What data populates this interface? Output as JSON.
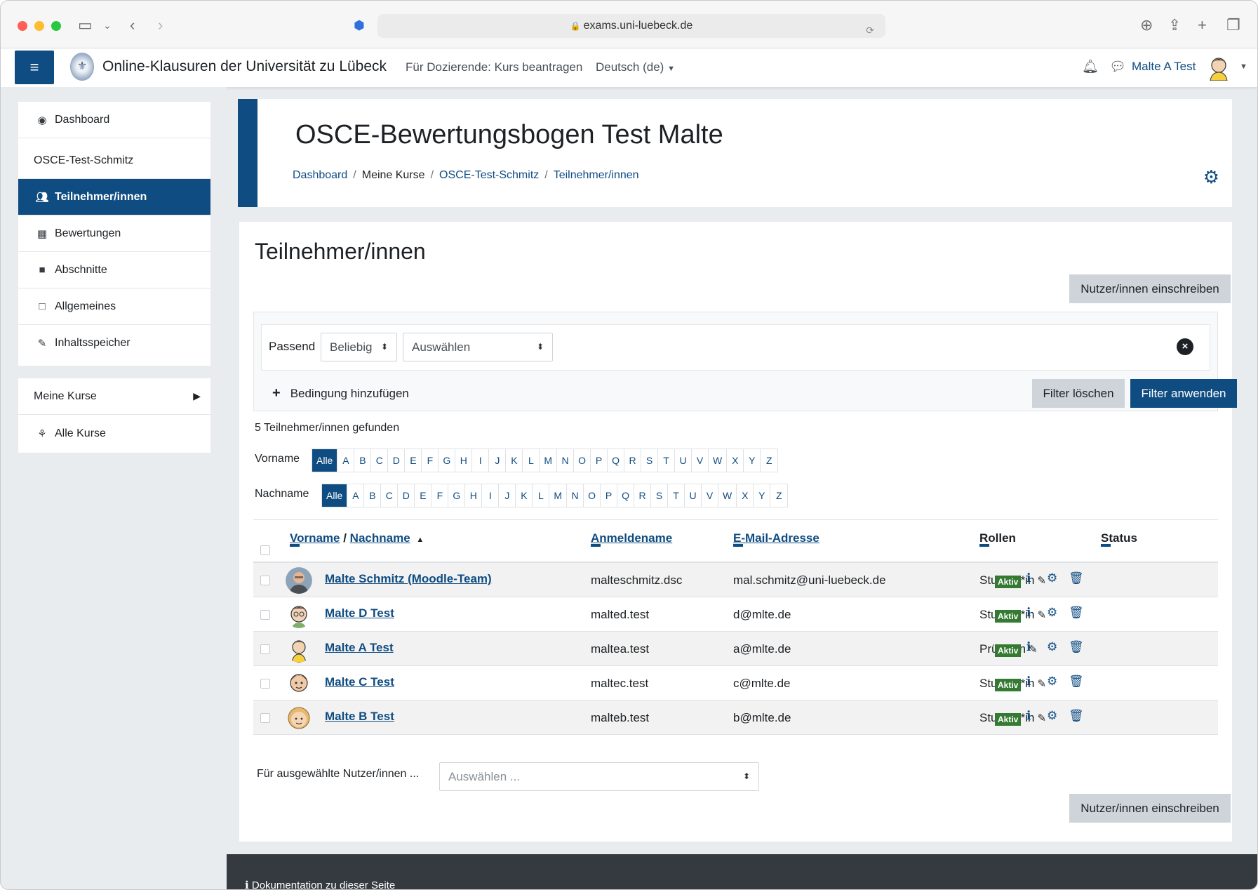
{
  "browser": {
    "url": "exams.uni-luebeck.de"
  },
  "navbar": {
    "site_name": "Online-Klausuren der Universität zu Lübeck",
    "links": [
      "Für Dozierende: Kurs beantragen",
      "Deutsch (de)"
    ],
    "user_name": "Malte A Test"
  },
  "drawer": {
    "course_items": [
      {
        "label": "Dashboard",
        "icon": "dashboard-icon"
      },
      {
        "label": "OSCE-Test-Schmitz",
        "icon": ""
      },
      {
        "label": "Teilnehmer/innen",
        "icon": "users-icon",
        "active": true
      },
      {
        "label": "Bewertungen",
        "icon": "table-icon"
      },
      {
        "label": "Abschnitte",
        "icon": "folder-icon"
      },
      {
        "label": "Allgemeines",
        "icon": "folder-open-icon"
      },
      {
        "label": "Inhaltsspeicher",
        "icon": "brush-icon"
      }
    ],
    "global_items": [
      {
        "label": "Meine Kurse",
        "icon": ""
      },
      {
        "label": "Alle Kurse",
        "icon": "sitemap-icon"
      }
    ]
  },
  "header": {
    "title": "OSCE-Bewertungsbogen Test Malte",
    "breadcrumb": [
      "Dashboard",
      "Meine Kurse",
      "OSCE-Test-Schmitz",
      "Teilnehmer/innen"
    ]
  },
  "main": {
    "title": "Teilnehmer/innen",
    "enrol_button": "Nutzer/innen einschreiben",
    "filter": {
      "match_label": "Passend",
      "match_value": "Beliebig",
      "type_value": "Auswählen",
      "add_condition": "Bedingung hinzufügen",
      "clear_button": "Filter löschen",
      "apply_button": "Filter anwenden"
    },
    "found_text": "5 Teilnehmer/innen gefunden",
    "firstname_label": "Vorname",
    "lastname_label": "Nachname",
    "initials": [
      "Alle",
      "A",
      "B",
      "C",
      "D",
      "E",
      "F",
      "G",
      "H",
      "I",
      "J",
      "K",
      "L",
      "M",
      "N",
      "O",
      "P",
      "Q",
      "R",
      "S",
      "T",
      "U",
      "V",
      "W",
      "X",
      "Y",
      "Z"
    ],
    "table": {
      "headers": {
        "firstname": "Vorname",
        "slash": " / ",
        "lastname": "Nachname",
        "username": "Anmeldename",
        "email": "E-Mail-Adresse",
        "roles": "Rollen",
        "status": "Status"
      },
      "rows": [
        {
          "name": "Malte Schmitz (Moodle-Team)",
          "username": "malteschmitz.dsc",
          "email": "mal.schmitz@uni-luebeck.de",
          "role": "Student*in",
          "status": "Aktiv"
        },
        {
          "name": "Malte D Test",
          "username": "malted.test",
          "email": "d@mlte.de",
          "role": "Student*in",
          "status": "Aktiv"
        },
        {
          "name": "Malte A Test",
          "username": "maltea.test",
          "email": "a@mlte.de",
          "role": "Prüfer*in",
          "status": "Aktiv"
        },
        {
          "name": "Malte C Test",
          "username": "maltec.test",
          "email": "c@mlte.de",
          "role": "Student*in",
          "status": "Aktiv"
        },
        {
          "name": "Malte B Test",
          "username": "malteb.test",
          "email": "b@mlte.de",
          "role": "Student*in",
          "status": "Aktiv"
        }
      ]
    },
    "bulk_label": "Für ausgewählte Nutzer/innen ...",
    "bulk_placeholder": "Auswählen ..."
  },
  "footer": {
    "doc_link": "Dokumentation zu dieser Seite"
  },
  "colors": {
    "brand": "#0f4c81",
    "status_active": "#357a32"
  }
}
